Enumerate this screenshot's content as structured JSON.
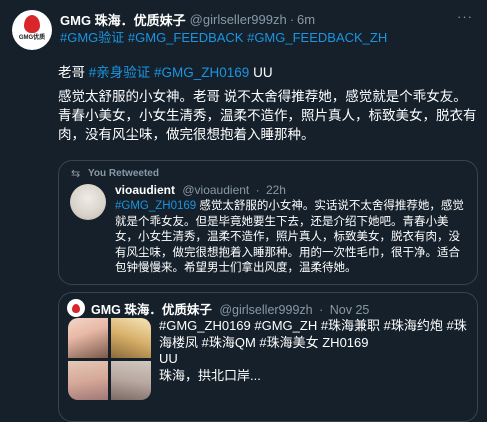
{
  "tweet": {
    "author_name": "GMG 珠海．优质妹子",
    "handle": "@girlseller999zh",
    "separator": "·",
    "time": "6m",
    "more": "···",
    "avatar_text": "GMG优质\n珠海",
    "tags_line": "#GMG验证 #GMG_FEEDBACK #GMG_FEEDBACK_ZH",
    "line2_prefix": "老哥 ",
    "line2_hash": "#亲身验证 #GMG_ZH0169",
    "line2_suffix": " UU",
    "paragraph": "感觉太舒服的小女神。老哥 说不太舍得推荐她，感觉就是个乖女友。青春小美女，小女生清秀，温柔不造作，照片真人，标致美女，脱衣有肉，没有风尘味，做完很想抱着入睡那种。"
  },
  "retweet": {
    "label": "You Retweeted",
    "author_name": "vioaudient",
    "handle": "@vioaudient",
    "separator": "·",
    "time": "22h",
    "hash": "#GMG_ZH0169",
    "text": " 感觉太舒服的小女神。实话说不太舍得推荐她，感觉就是个乖女友。但是毕竟她要生下去，还是介绍下她吧。青春小美女，小女生清秀，温柔不造作，照片真人，标致美女，脱衣有肉，没有风尘味，做完很想抱着入睡那种。用的一次性毛巾，很干净。适合包钟慢慢来。希望男士们拿出风度，温柔待她。"
  },
  "quote": {
    "author_name": "GMG 珠海．优质妹子",
    "handle": "@girlseller999zh",
    "separator": "·",
    "time": "Nov 25",
    "hash_lines": "#GMG_ZH0169 #GMG_ZH #珠海兼职 #珠海约炮 #珠海楼凤 #珠海QM #珠海美女 ZH0169",
    "line_uu": "UU",
    "line_loc": "珠海，拱北口岸..."
  },
  "colors": {
    "background": "#15202b",
    "link": "#1b95e0",
    "muted": "#8899a6",
    "border": "#38444d",
    "brand_red": "#d8262a"
  }
}
